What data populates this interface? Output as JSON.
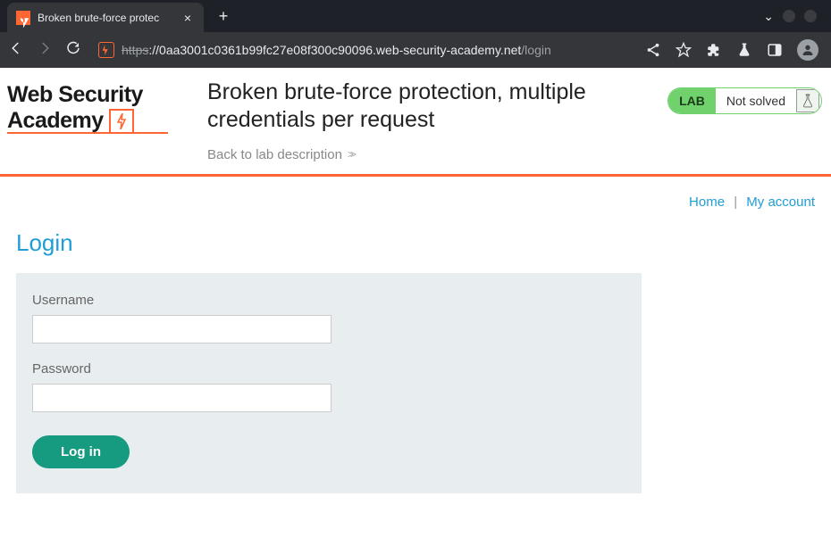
{
  "browser": {
    "tab_title": "Broken brute-force protec",
    "url_protocol": "https",
    "url_host": "://0aa3001c0361b99fc27e08f300c90096.web-security-academy.net",
    "url_path": "/login"
  },
  "logo": {
    "line1": "Web Security",
    "line2": "Academy"
  },
  "header": {
    "title": "Broken brute-force protection, multiple credentials per request",
    "back_link": "Back to lab description"
  },
  "status": {
    "badge": "LAB",
    "text": "Not solved"
  },
  "nav": {
    "home": "Home",
    "account": "My account"
  },
  "login": {
    "heading": "Login",
    "username_label": "Username",
    "password_label": "Password",
    "button": "Log in"
  }
}
